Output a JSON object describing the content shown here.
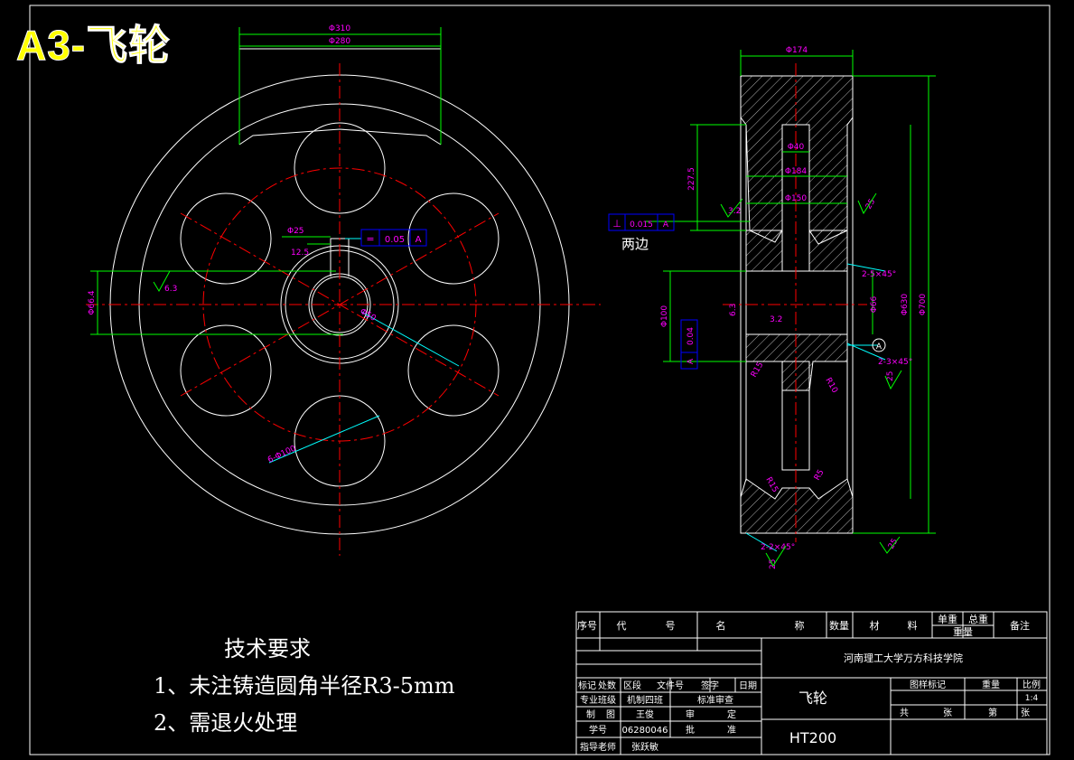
{
  "stamp": "A3-飞轮",
  "colors": {
    "background": "#000000",
    "outline": "#ffffff",
    "centerline": "#ff0000",
    "dimension": "#00ff00",
    "dim_text": "#ff00ff",
    "leader": "#00ffff",
    "tolerance_frame": "#0000ff",
    "stamp": "#ffff00"
  },
  "front_view": {
    "dims": {
      "outer_slot": "Φ310",
      "inner_slot": "Φ280",
      "keyway_width": "Φ25",
      "keyway_depth": "12.5",
      "left_hub": "Φ66.4",
      "roughness_left": "6.3",
      "bore": "Φ50",
      "holes": "6-Φ100",
      "tolerance_symbol": "=",
      "tolerance_value": "0.05",
      "tolerance_datum": "A"
    }
  },
  "side_view": {
    "dims": {
      "rim_width": "Φ174",
      "web_thk": "Φ40",
      "hub_len": "Φ184",
      "hub_dia": "Φ150",
      "slot_depth": "227.5",
      "roughness_web": "3.2",
      "roughness_rim": "25",
      "runout_symbol": "⊥",
      "runout_value": "0.015",
      "runout_datum": "A",
      "both_sides": "两边",
      "outer_dia": "Φ700",
      "inner_dia": "Φ630",
      "hub_outer": "Φ66",
      "bore_dia": "Φ100",
      "left_small": "6.3",
      "hub_rough": "3.2",
      "datum": "A",
      "chamfer_1": "2-5×45°",
      "chamfer_2": "2-3×45°",
      "chamfer_3": "2-2×45°",
      "r15": "R15",
      "r10": "R10",
      "r5": "R5",
      "rough_top": "25",
      "rough_bottom_left": "25",
      "rough_bottom_right": "25",
      "rough_right": "25",
      "pos_tol_value": "0.04",
      "pos_tol_datum": "A"
    }
  },
  "tech_requirements": {
    "title": "技术要求",
    "line1": "1、未注铸造圆角半径R3-5mm",
    "line2": "2、需退火处理"
  },
  "title_block": {
    "header": [
      "序号",
      "代",
      "号",
      "名",
      "称",
      "数量",
      "材",
      "料",
      "单重",
      "总重",
      "备注"
    ],
    "weight_row": "重量",
    "school": "河南理工大学万方科技学院",
    "part_name": "飞轮",
    "material": "HT200",
    "rev_row": [
      "标记",
      "处数",
      "区段",
      "文件号",
      "签字",
      "日期"
    ],
    "design_row": [
      "专业班级",
      "机制四班",
      "标准审查"
    ],
    "draw_row": [
      "制",
      "图",
      "王俊",
      "审",
      "定"
    ],
    "id_row": [
      "学号",
      "06280046",
      "批",
      "准"
    ],
    "teacher_row": [
      "指导老师",
      "张跃敏"
    ],
    "stage_label": "图样标记",
    "weight_label": "重量",
    "scale_label": "比例",
    "scale_value": "1:4",
    "sheet_total": "共",
    "sheet_unit": "张",
    "sheet_no": "第",
    "sheet_unit2": "张"
  }
}
